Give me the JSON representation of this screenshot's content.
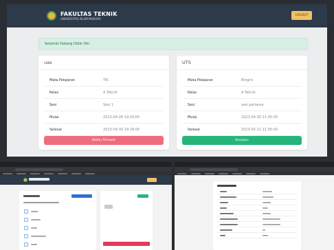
{
  "header": {
    "brand_title": "FAKULTAS TEKNIK",
    "brand_subtitle": "UNIVERSITAS ISLAM MADURA",
    "logout_label": "LOGOUT"
  },
  "welcome": {
    "text": "Selamat Datang Didin Oki"
  },
  "cards": [
    {
      "title": "uas",
      "rows": [
        {
          "label": "Mata Pelajaran",
          "value": "TIK"
        },
        {
          "label": "Kelas",
          "value": "A Teknik"
        },
        {
          "label": "Sesi",
          "value": "Sesi 1"
        },
        {
          "label": "Mulai",
          "value": "2023-04-28 19:29:00"
        },
        {
          "label": "Selesai",
          "value": "2023-04-30 19:29:00"
        }
      ],
      "button_label": "Waktu Terlewat",
      "button_color": "#ee6c7e"
    },
    {
      "title": "UTS",
      "rows": [
        {
          "label": "Mata Pelajaran",
          "value": "Bingris"
        },
        {
          "label": "Kelas",
          "value": "A Teknik"
        },
        {
          "label": "Sesi",
          "value": "sesi pertama"
        },
        {
          "label": "Mulai",
          "value": "2023-04-30 21:05:00"
        },
        {
          "label": "Selesai",
          "value": "2023-05-11 21:05:00"
        }
      ],
      "button_label": "Kerjakan",
      "button_color": "#25b57a"
    }
  ],
  "colors": {
    "topbar": "#2c3a49",
    "accent_logout": "#f2c065",
    "welcome_bg": "#d7efe4"
  }
}
